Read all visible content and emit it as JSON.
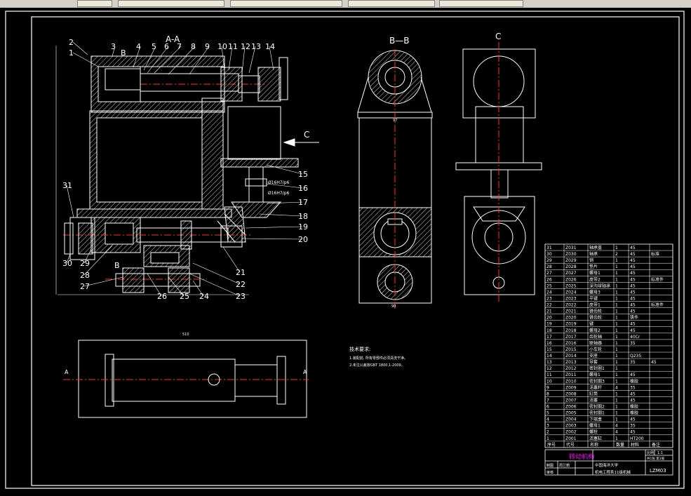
{
  "taskbar": {
    "tabs": [
      "",
      "",
      "",
      "",
      "",
      ""
    ]
  },
  "drawing": {
    "view_labels": {
      "section_aa": "A-A",
      "section_bb": "B—B",
      "view_c": "C",
      "arrow_c": "C",
      "mark_b": "B",
      "mark_a": "A"
    },
    "callouts": [
      "1",
      "2",
      "3",
      "4",
      "5",
      "6",
      "7",
      "8",
      "9",
      "10",
      "11",
      "12",
      "13",
      "14",
      "15",
      "16",
      "17",
      "18",
      "19",
      "20",
      "21",
      "22",
      "23",
      "24",
      "25",
      "26",
      "27",
      "28",
      "29",
      "30",
      "31"
    ],
    "fits": [
      "Ø16H7/p6",
      "Ø16H7/p6"
    ],
    "dimensions": {
      "bottom_width": "510",
      "bb_top": "97",
      "bb_bottom": "90"
    },
    "tech_requirements": {
      "title": "技术要求:",
      "items": [
        "1.装配前, 所有零部件必须清洗干净。",
        "2.未注公差按GBT 1800.1-2009。"
      ]
    },
    "bom": {
      "rows": [
        [
          "31",
          "Z031",
          "轴承盖",
          "1",
          "45",
          ""
        ],
        [
          "30",
          "Z030",
          "轴承",
          "2",
          "45",
          "标准"
        ],
        [
          "29",
          "Z029",
          "销",
          "1",
          "45",
          ""
        ],
        [
          "28",
          "Z028",
          "垫片",
          "1",
          "45",
          ""
        ],
        [
          "27",
          "Z027",
          "螺母1",
          "1",
          "45",
          ""
        ],
        [
          "26",
          "Z026",
          "皮带2",
          "1",
          "45",
          "标准件"
        ],
        [
          "25",
          "Z025",
          "深沟球轴承",
          "1",
          "45",
          ""
        ],
        [
          "24",
          "Z024",
          "螺母3",
          "1",
          "45",
          ""
        ],
        [
          "23",
          "Z023",
          "平键",
          "1",
          "45",
          ""
        ],
        [
          "22",
          "Z022",
          "皮带1",
          "1",
          "45",
          "标准件"
        ],
        [
          "21",
          "Z021",
          "锥齿轮",
          "1",
          "45",
          ""
        ],
        [
          "20",
          "Z020",
          "锥齿轮",
          "1",
          "铸件",
          ""
        ],
        [
          "19",
          "Z019",
          "键",
          "1",
          "45",
          ""
        ],
        [
          "18",
          "Z018",
          "螺母2",
          "1",
          "45",
          ""
        ],
        [
          "17",
          "Z017",
          "齿轮轴",
          "1",
          "40Cr",
          ""
        ],
        [
          "16",
          "Z016",
          "联轴器",
          "1",
          "35",
          ""
        ],
        [
          "15",
          "Z015",
          "小车轮",
          "1",
          "",
          ""
        ],
        [
          "14",
          "Z014",
          "支座",
          "1",
          "Q235",
          ""
        ],
        [
          "13",
          "Z013",
          "导套",
          "1",
          "35",
          "45"
        ],
        [
          "12",
          "Z012",
          "密封圈1",
          "1",
          "",
          ""
        ],
        [
          "11",
          "Z011",
          "螺母1",
          "1",
          "45",
          ""
        ],
        [
          "10",
          "Z010",
          "密封圈3",
          "1",
          "橡胶",
          ""
        ],
        [
          "9",
          "Z009",
          "活塞杆",
          "4",
          "35",
          ""
        ],
        [
          "8",
          "Z008",
          "缸筒",
          "1",
          "45",
          ""
        ],
        [
          "7",
          "Z007",
          "活塞",
          "1",
          "45",
          ""
        ],
        [
          "6",
          "Z006",
          "密封圈2",
          "1",
          "橡胶",
          ""
        ],
        [
          "5",
          "Z005",
          "密封圈1",
          "1",
          "橡胶",
          ""
        ],
        [
          "4",
          "Z004",
          "下端盖",
          "1",
          "45",
          ""
        ],
        [
          "3",
          "Z003",
          "螺母1",
          "4",
          "35",
          ""
        ],
        [
          "2",
          "Z002",
          "螺栓",
          "4",
          "45",
          ""
        ],
        [
          "1",
          "Z001",
          "活塞缸",
          "1",
          "HT200",
          ""
        ]
      ],
      "header": [
        "序号",
        "代号",
        "名称",
        "数量",
        "材料",
        "备注"
      ]
    },
    "title_block": {
      "title": "转动机构",
      "ratio_label": "比例",
      "ratio": "1:1",
      "sheet": "共1张 第1张",
      "drawn_by_label": "制图",
      "drawn_by": "周兰丽",
      "review_label": "审核",
      "school_line1": "中国海洋大学",
      "school_line2": "机电工程系11级机械",
      "code": "LZM03"
    },
    "colors": {
      "line": "#ffffff",
      "center": "#ff3030",
      "hatch": "#ffffff",
      "title": "#ff00ff",
      "bg": "#000000"
    }
  }
}
